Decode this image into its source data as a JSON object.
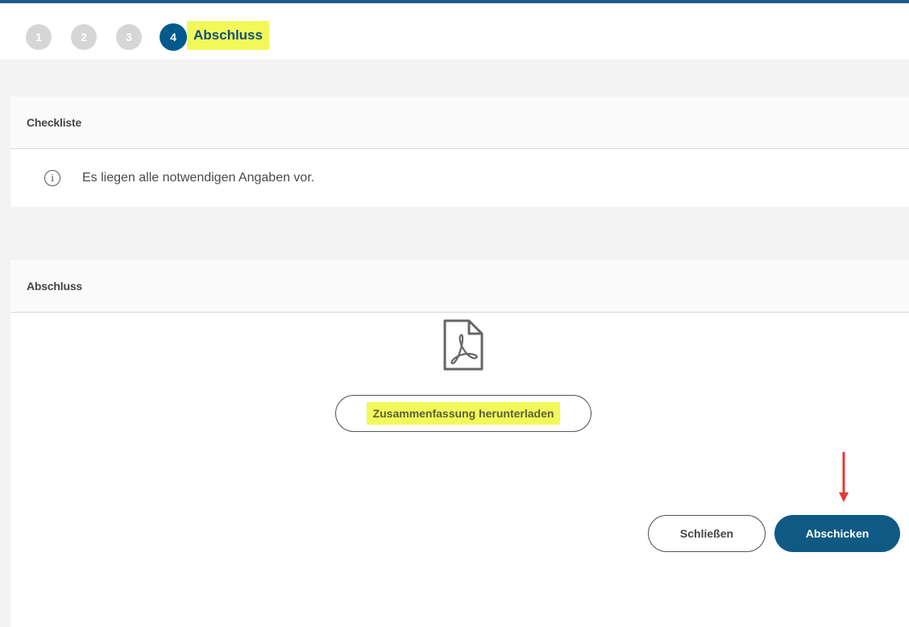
{
  "stepper": {
    "steps": [
      "1",
      "2",
      "3",
      "4"
    ],
    "active_step": "4",
    "active_title": "Abschluss"
  },
  "checklist": {
    "heading": "Checkliste",
    "info_icon": "info-icon",
    "message": "Es liegen alle notwendigen Angaben vor."
  },
  "completion": {
    "heading": "Abschluss",
    "document_icon": "pdf-file-icon",
    "download_label": "Zusammenfassung herunterladen",
    "close_label": "Schließen",
    "submit_label": "Abschicken"
  },
  "colors": {
    "primary": "#0f5a84",
    "highlight": "#f1f95a",
    "inactive_step": "#d6d6d6",
    "annotation_arrow": "#e53935"
  }
}
